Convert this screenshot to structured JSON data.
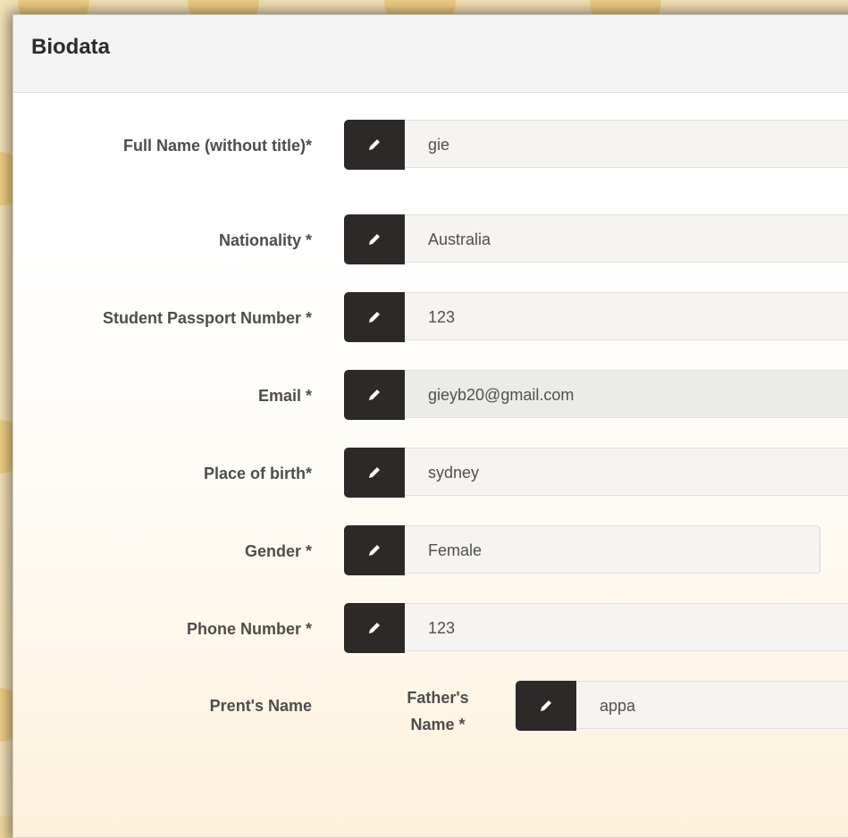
{
  "panel": {
    "title": "Biodata"
  },
  "fields": {
    "full_name": {
      "label": "Full Name (without title)*",
      "value": "gie"
    },
    "nationality": {
      "label": "Nationality *",
      "value": "Australia"
    },
    "passport": {
      "label": "Student Passport Number *",
      "value": "123"
    },
    "email": {
      "label": "Email *",
      "value": "gieyb20@gmail.com"
    },
    "place_of_birth": {
      "label": "Place of birth*",
      "value": "sydney"
    },
    "gender": {
      "label": "Gender *",
      "value": "Female"
    },
    "phone": {
      "label": "Phone Number *",
      "value": "123"
    },
    "parents": {
      "label": "Prent's Name",
      "father_label_line1": "Father's",
      "father_label_line2": "Name *",
      "father_value": "appa"
    }
  },
  "icons": {
    "field_button": "pencil-icon"
  },
  "colors": {
    "button_bg": "#2d2929",
    "input_bg": "#f5f4f1",
    "page_bg": "#fdf1dc",
    "decor": "#f3d9a0"
  }
}
